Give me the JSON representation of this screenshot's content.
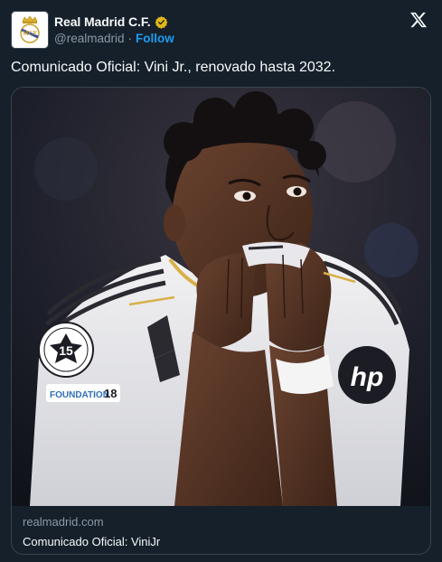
{
  "author": {
    "name": "Real Madrid C.F.",
    "handle": "@realmadrid",
    "separator": "·",
    "follow_label": "Follow",
    "avatar_icon": "real-madrid-crest",
    "verified_color": "#e2b719"
  },
  "platform_icon": "x-logo-icon",
  "tweet": {
    "text": "Comunicado Oficial: Vini Jr., renovado hasta 2032."
  },
  "card": {
    "domain": "realmadrid.com",
    "title": "Comunicado Oficial: ViniJr",
    "image_description_icon": "player-photo",
    "badge_number": "15",
    "sleeve_text": "FOUNDATION",
    "sleeve_number": "18"
  },
  "colors": {
    "background": "#15202b",
    "accent": "#1d9bf0",
    "muted": "#8b98a5",
    "border": "#38444d"
  }
}
